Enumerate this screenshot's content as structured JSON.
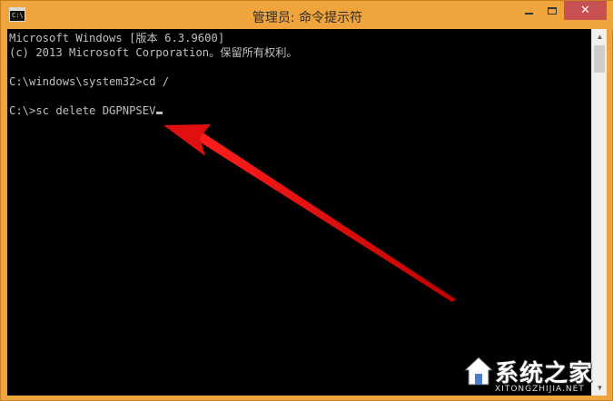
{
  "window": {
    "title": "管理员: 命令提示符",
    "icon_label": "C:\\.",
    "controls": {
      "close": "✕"
    }
  },
  "console": {
    "lines": [
      "Microsoft Windows [版本 6.3.9600]",
      "(c) 2013 Microsoft Corporation。保留所有权利。",
      "",
      "C:\\windows\\system32>cd /",
      "",
      "C:\\>sc delete DGPNPSEV"
    ]
  },
  "scrollbar": {
    "up": "▲",
    "down": "▼"
  },
  "annotation": {
    "color": "#e01010",
    "type": "arrow",
    "target": "command-line"
  },
  "watermark": {
    "text": "系统之家",
    "sub": "XITONGZHIJIA.NET"
  },
  "colors": {
    "accent": "#f0a43c",
    "console_bg": "#000000",
    "console_fg": "#c0c0c0"
  }
}
